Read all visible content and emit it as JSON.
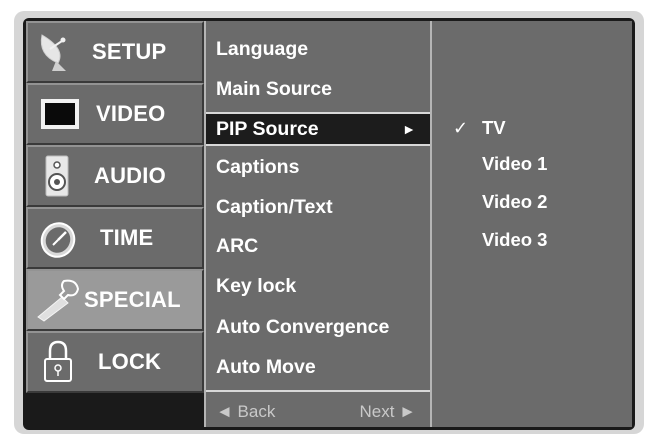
{
  "tabs": [
    {
      "label": "SETUP",
      "icon": "satellite-dish-icon"
    },
    {
      "label": "VIDEO",
      "icon": "tv-screen-icon"
    },
    {
      "label": "AUDIO",
      "icon": "speaker-icon"
    },
    {
      "label": "TIME",
      "icon": "clock-icon"
    },
    {
      "label": "SPECIAL",
      "icon": "wrench-key-icon"
    },
    {
      "label": "LOCK",
      "icon": "padlock-icon"
    }
  ],
  "active_tab": "SPECIAL",
  "menu": {
    "items": [
      {
        "label": "Language"
      },
      {
        "label": "Main Source"
      },
      {
        "label": "PIP Source",
        "arrow": "►"
      },
      {
        "label": "Captions"
      },
      {
        "label": "Caption/Text"
      },
      {
        "label": "ARC"
      },
      {
        "label": "Key lock"
      },
      {
        "label": "Auto Convergence"
      },
      {
        "label": "Auto Move"
      }
    ],
    "selected": "PIP Source",
    "back_label": "◄ Back",
    "next_label": "Next ►"
  },
  "submenu": {
    "check_mark": "✓",
    "options": [
      {
        "label": "TV"
      },
      {
        "label": "Video 1"
      },
      {
        "label": "Video 2"
      },
      {
        "label": "Video 3"
      }
    ],
    "checked": "TV"
  }
}
